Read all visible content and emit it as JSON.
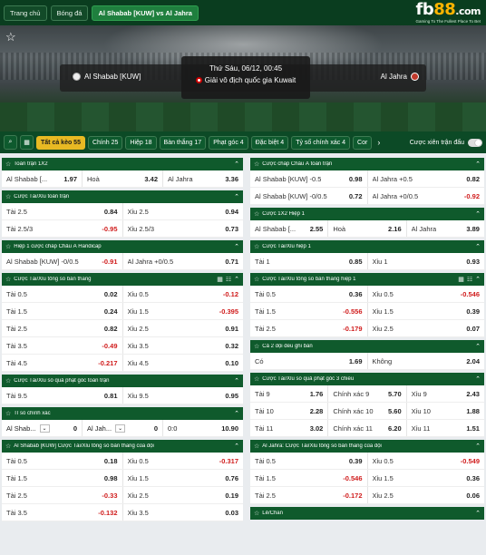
{
  "nav": {
    "home": "Trang chủ",
    "football": "Bóng đá",
    "match": "Al Shabab [KUW] vs Al Jahra"
  },
  "logo": {
    "main_a": "fb",
    "main_b": "88",
    "main_c": ".com",
    "tagline": "Gaming To The Fullest Place To Bet"
  },
  "match": {
    "home": "Al Shabab [KUW]",
    "away": "Al Jahra",
    "time": "Thứ Sáu, 06/12, 00:45",
    "league": "Giải vô địch quốc gia Kuwait"
  },
  "filters": [
    "Tất cả kèo 55",
    "Chính 25",
    "Hiệp 18",
    "Bàn thắng 17",
    "Phạt góc 4",
    "Đặc biệt 4",
    "Tỷ số chính xác 4",
    "Cor"
  ],
  "corner_label": "Cược xiên trận đấu",
  "left": {
    "m1": {
      "title": "Toàn trận 1X2",
      "rows": [
        [
          {
            "l": "Al Shabab [...",
            "o": "1.97"
          },
          {
            "l": "Hoà",
            "o": "3.42"
          },
          {
            "l": "Al Jahra",
            "o": "3.36"
          }
        ]
      ]
    },
    "m2": {
      "title": "Cược Tài/Xỉu toàn trận",
      "rows": [
        [
          {
            "l": "Tài 2.5",
            "o": "0.84"
          },
          {
            "l": "Xỉu 2.5",
            "o": "0.94"
          }
        ],
        [
          {
            "l": "Tài 2.5/3",
            "o": "-0.95"
          },
          {
            "l": "Xỉu 2.5/3",
            "o": "0.73"
          }
        ]
      ]
    },
    "m3": {
      "title": "Hiệp 1 cược chấp Châu Á Handicap",
      "rows": [
        [
          {
            "l": "Al Shabab [KUW] -0/0.5",
            "o": "-0.91"
          },
          {
            "l": "Al Jahra +0/0.5",
            "o": "0.71"
          }
        ]
      ]
    },
    "m4": {
      "title": "Cược Tài/Xỉu tổng số bàn thắng",
      "rows": [
        [
          {
            "l": "Tài 0.5",
            "o": "0.02"
          },
          {
            "l": "Xỉu 0.5",
            "o": "-0.12"
          }
        ],
        [
          {
            "l": "Tài 1.5",
            "o": "0.24"
          },
          {
            "l": "Xỉu 1.5",
            "o": "-0.395"
          }
        ],
        [
          {
            "l": "Tài 2.5",
            "o": "0.82"
          },
          {
            "l": "Xỉu 2.5",
            "o": "0.91"
          }
        ],
        [
          {
            "l": "Tài 3.5",
            "o": "-0.49"
          },
          {
            "l": "Xỉu 3.5",
            "o": "0.32"
          }
        ],
        [
          {
            "l": "Tài 4.5",
            "o": "-0.217"
          },
          {
            "l": "Xỉu 4.5",
            "o": "0.10"
          }
        ]
      ]
    },
    "m5": {
      "title": "Cược Tài/Xỉu số quả phạt góc toàn trận",
      "rows": [
        [
          {
            "l": "Tài 9.5",
            "o": "0.81"
          },
          {
            "l": "Xỉu 9.5",
            "o": "0.95"
          }
        ]
      ]
    },
    "m6": {
      "title": "Tỉ số chính xác",
      "home": "Al Shab...",
      "home_score": "0",
      "away": "Al Jah...",
      "away_score": "0",
      "score": "0:0",
      "odd": "10.90"
    },
    "m7": {
      "title": "Al Shabab [KUW] Cược Tài/Xỉu tổng số bàn thắng của đội",
      "rows": [
        [
          {
            "l": "Tài 0.5",
            "o": "0.18"
          },
          {
            "l": "Xỉu 0.5",
            "o": "-0.317"
          }
        ],
        [
          {
            "l": "Tài 1.5",
            "o": "0.98"
          },
          {
            "l": "Xỉu 1.5",
            "o": "0.76"
          }
        ],
        [
          {
            "l": "Tài 2.5",
            "o": "-0.33"
          },
          {
            "l": "Xỉu 2.5",
            "o": "0.19"
          }
        ],
        [
          {
            "l": "Tài 3.5",
            "o": "-0.132"
          },
          {
            "l": "Xỉu 3.5",
            "o": "0.03"
          }
        ]
      ]
    }
  },
  "right": {
    "m1": {
      "title": "Cược chấp Châu Á toàn trận",
      "rows": [
        [
          {
            "l": "Al Shabab [KUW] -0.5",
            "o": "0.98"
          },
          {
            "l": "Al Jahra +0.5",
            "o": "0.82"
          }
        ],
        [
          {
            "l": "Al Shabab [KUW] -0/0.5",
            "o": "0.72"
          },
          {
            "l": "Al Jahra +0/0.5",
            "o": "-0.92"
          }
        ]
      ]
    },
    "m2": {
      "title": "Cược 1X2 Hiệp 1",
      "rows": [
        [
          {
            "l": "Al Shabab [...",
            "o": "2.55"
          },
          {
            "l": "Hoà",
            "o": "2.16"
          },
          {
            "l": "Al Jahra",
            "o": "3.89"
          }
        ]
      ]
    },
    "m3": {
      "title": "Cược Tài/Xỉu hiệp 1",
      "rows": [
        [
          {
            "l": "Tài 1",
            "o": "0.85"
          },
          {
            "l": "Xỉu 1",
            "o": "0.93"
          }
        ]
      ]
    },
    "m4": {
      "title": "Cược Tài/Xỉu tổng số bàn thắng hiệp 1",
      "rows": [
        [
          {
            "l": "Tài 0.5",
            "o": "0.36"
          },
          {
            "l": "Xỉu 0.5",
            "o": "-0.546"
          }
        ],
        [
          {
            "l": "Tài 1.5",
            "o": "-0.556"
          },
          {
            "l": "Xỉu 1.5",
            "o": "0.39"
          }
        ],
        [
          {
            "l": "Tài 2.5",
            "o": "-0.179"
          },
          {
            "l": "Xỉu 2.5",
            "o": "0.07"
          }
        ]
      ]
    },
    "m5": {
      "title": "Cả 2 đội đều ghi bàn",
      "rows": [
        [
          {
            "l": "Có",
            "o": "1.69"
          },
          {
            "l": "Không",
            "o": "2.04"
          }
        ]
      ]
    },
    "m6": {
      "title": "Cược Tài/Xỉu số quả phạt góc 3 chiều",
      "rows": [
        [
          {
            "l": "Tài 9",
            "o": "1.76"
          },
          {
            "l": "Chính xác 9",
            "o": "5.70"
          },
          {
            "l": "Xỉu 9",
            "o": "2.43"
          }
        ],
        [
          {
            "l": "Tài 10",
            "o": "2.28"
          },
          {
            "l": "Chính xác 10",
            "o": "5.60"
          },
          {
            "l": "Xỉu 10",
            "o": "1.88"
          }
        ],
        [
          {
            "l": "Tài 11",
            "o": "3.02"
          },
          {
            "l": "Chính xác 11",
            "o": "6.20"
          },
          {
            "l": "Xỉu 11",
            "o": "1.51"
          }
        ]
      ]
    },
    "m7": {
      "title": "Al Jahra: Cược Tài/Xỉu tổng số bàn thắng của đội",
      "rows": [
        [
          {
            "l": "Tài 0.5",
            "o": "0.39"
          },
          {
            "l": "Xỉu 0.5",
            "o": "-0.549"
          }
        ],
        [
          {
            "l": "Tài 1.5",
            "o": "-0.546"
          },
          {
            "l": "Xỉu 1.5",
            "o": "0.36"
          }
        ],
        [
          {
            "l": "Tài 2.5",
            "o": "-0.172"
          },
          {
            "l": "Xỉu 2.5",
            "o": "0.06"
          }
        ]
      ]
    },
    "m8": {
      "title": "Lẻ/Chẵn"
    }
  }
}
